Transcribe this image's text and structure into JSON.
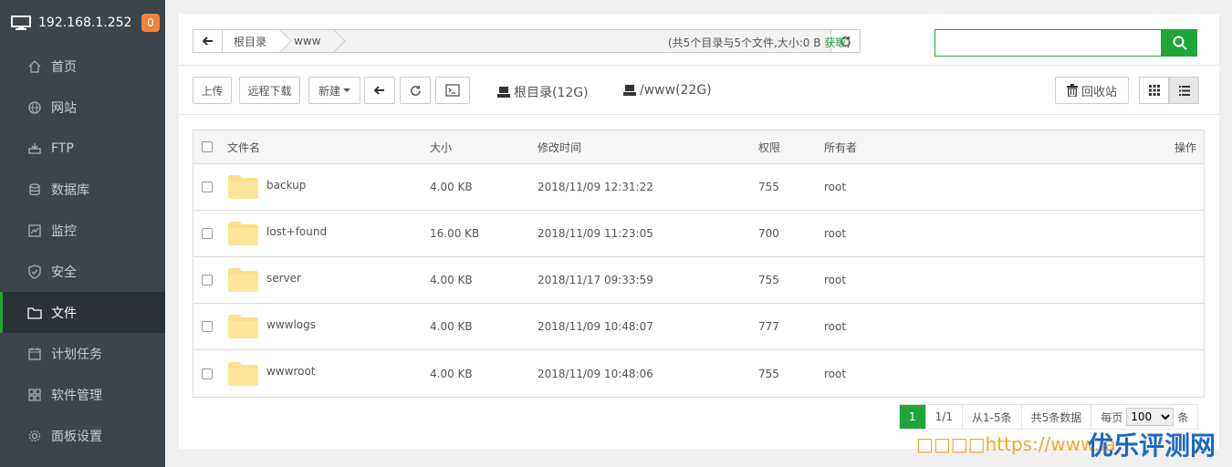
{
  "sidebar": {
    "host": "192.168.1.252",
    "badge": "0",
    "items": [
      {
        "label": "首页",
        "icon": "home-icon"
      },
      {
        "label": "网站",
        "icon": "globe-icon"
      },
      {
        "label": "FTP",
        "icon": "ftp-icon"
      },
      {
        "label": "数据库",
        "icon": "database-icon"
      },
      {
        "label": "监控",
        "icon": "monitor-icon"
      },
      {
        "label": "安全",
        "icon": "shield-icon"
      },
      {
        "label": "文件",
        "icon": "folder-icon",
        "active": true
      },
      {
        "label": "计划任务",
        "icon": "calendar-icon"
      },
      {
        "label": "软件管理",
        "icon": "grid-icon"
      },
      {
        "label": "面板设置",
        "icon": "gear-icon"
      }
    ]
  },
  "path": {
    "crumb1": "根目录",
    "crumb2": "www"
  },
  "summary": {
    "text": "(共5个目录与5个文件,大小:0 B ",
    "get": "获取",
    "end": ")"
  },
  "search": {
    "placeholder": "",
    "value": ""
  },
  "toolbar": {
    "upload": "上传",
    "remote_download": "远程下载",
    "new": "新建",
    "disk1": "根目录(12G)",
    "disk2": "/www(22G)",
    "recycle": "回收站"
  },
  "table": {
    "headers": [
      "文件名",
      "大小",
      "修改时间",
      "权限",
      "所有者",
      "操作"
    ],
    "rows": [
      {
        "name": "backup",
        "size": "4.00 KB",
        "mtime": "2018/11/09 12:31:22",
        "perm": "755",
        "owner": "root"
      },
      {
        "name": "lost+found",
        "size": "16.00 KB",
        "mtime": "2018/11/09 11:23:05",
        "perm": "700",
        "owner": "root"
      },
      {
        "name": "server",
        "size": "4.00 KB",
        "mtime": "2018/11/17 09:33:59",
        "perm": "755",
        "owner": "root"
      },
      {
        "name": "wwwlogs",
        "size": "4.00 KB",
        "mtime": "2018/11/09 10:48:07",
        "perm": "777",
        "owner": "root"
      },
      {
        "name": "wwwroot",
        "size": "4.00 KB",
        "mtime": "2018/11/09 10:48:06",
        "perm": "755",
        "owner": "root"
      }
    ]
  },
  "pager": {
    "current": "1",
    "pages": "1/1",
    "range": "从1-5条",
    "total": "共5条数据",
    "per_page_label": "每页",
    "per_page": "100",
    "unit": "条"
  },
  "watermark": {
    "url": "□□□□https://www.la",
    "cn": "优乐评测网"
  },
  "colors": {
    "accent": "#20a53a",
    "sidebar": "#3c444d",
    "badge": "#f0833a"
  }
}
